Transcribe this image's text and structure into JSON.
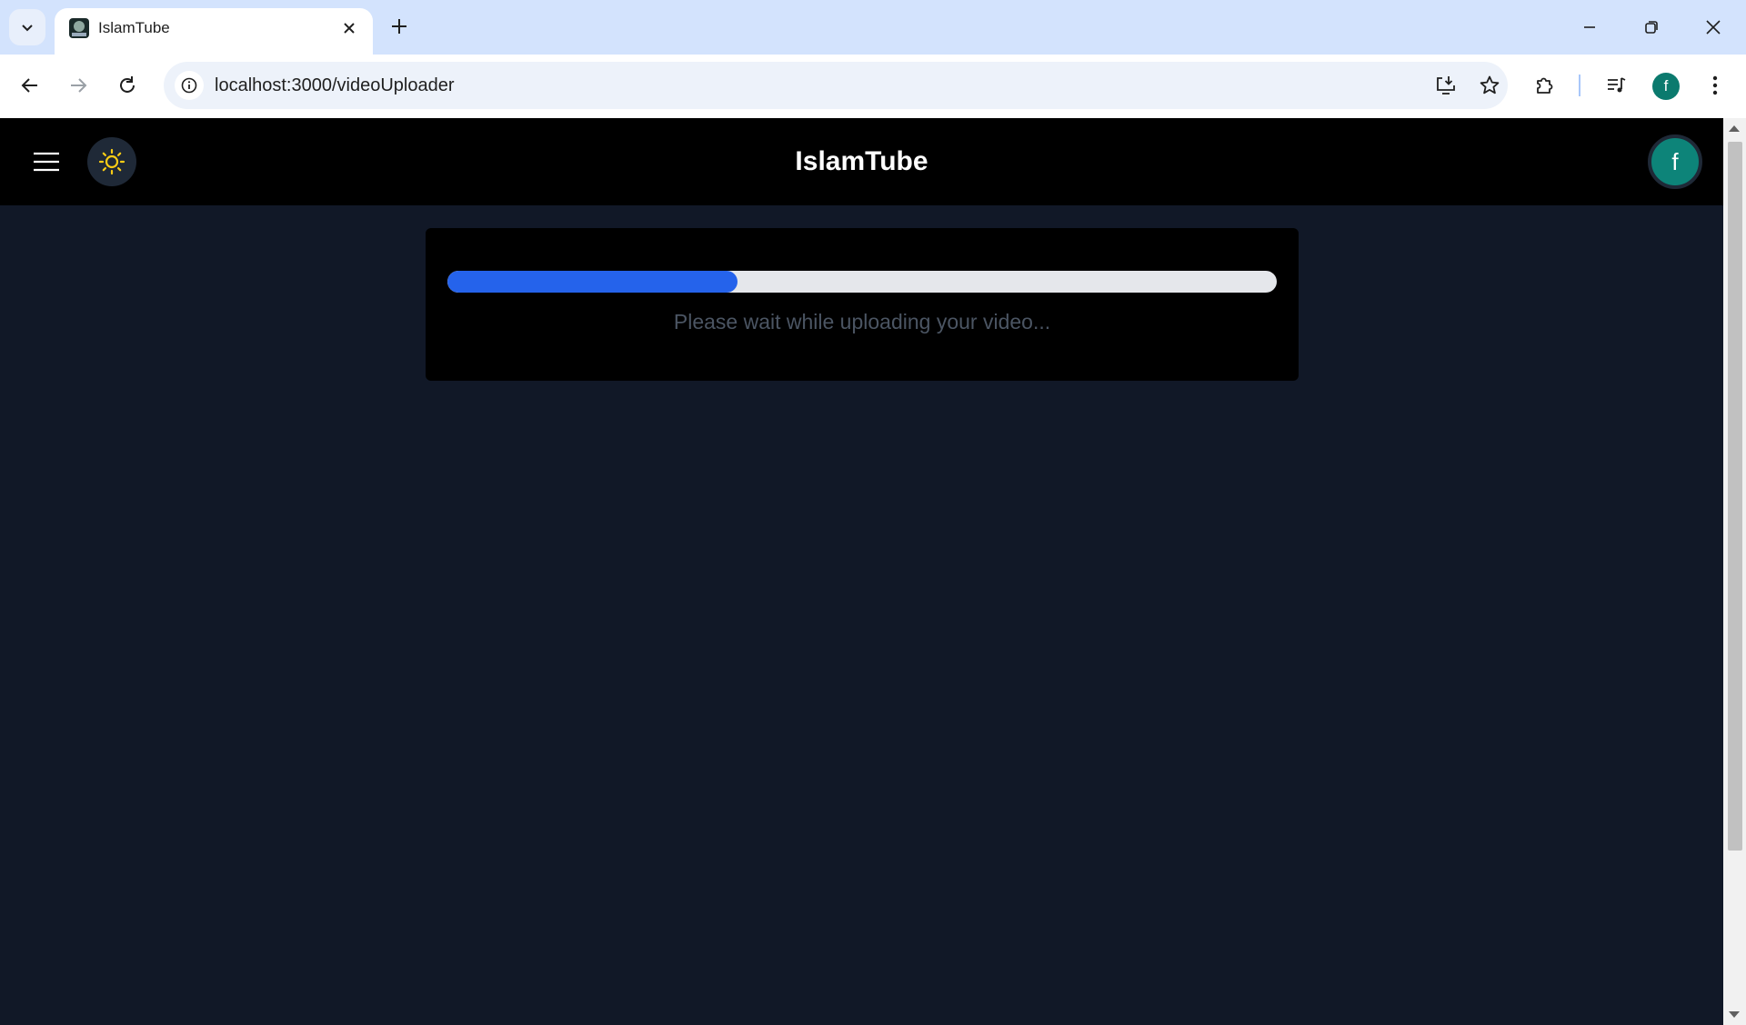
{
  "browser": {
    "tab_title": "IslamTube",
    "url": "localhost:3000/videoUploader",
    "profile_initial": "f"
  },
  "app": {
    "brand": "IslamTube",
    "avatar_initial": "f"
  },
  "upload": {
    "progress_percent": 35,
    "message": "Please wait while uploading your video..."
  },
  "icons": {
    "tab_search": "chevron-down-icon",
    "tab_close": "close-icon",
    "new_tab": "plus-icon",
    "back": "arrow-left-icon",
    "forward": "arrow-right-icon",
    "reload": "reload-icon",
    "site_info": "info-icon",
    "install": "install-app-icon",
    "bookmark": "star-icon",
    "extensions": "puzzle-icon",
    "media": "media-control-icon",
    "menu": "more-vertical-icon",
    "hamburger": "menu-icon",
    "theme": "sun-icon"
  },
  "colors": {
    "page_bg": "#111827",
    "header_bg": "#000000",
    "progress_fill": "#2563eb",
    "progress_track": "#e5e7eb",
    "sun": "#facc15",
    "avatar": "#0d8479"
  }
}
